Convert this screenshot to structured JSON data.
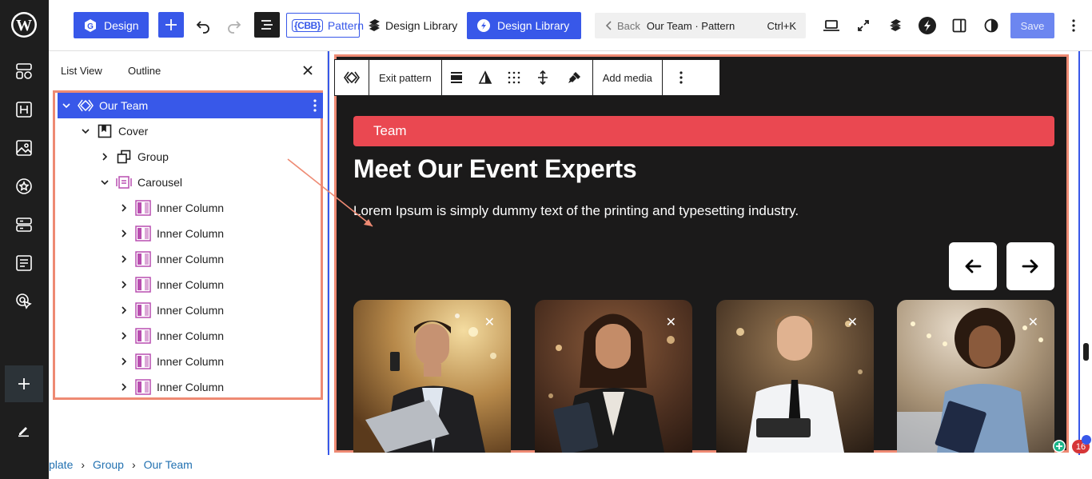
{
  "colors": {
    "accent": "#3858e9",
    "highlight": "#ee8a73",
    "team_pill": "#ea4851",
    "canvas_bg": "#1b1a1a"
  },
  "rail": {
    "icons": [
      "wordpress-logo-icon",
      "layout-icon",
      "heading-icon",
      "image-icon",
      "star-icon",
      "sections-icon",
      "form-icon",
      "cursor-click-icon",
      "plus-icon",
      "pencil-icon"
    ]
  },
  "toolbar": {
    "design_label": "Design",
    "pattern_label": "Pattern",
    "pattern_logo": "{CBB}",
    "design_library_label": "Design Library",
    "design_library_active_label": "Design Library",
    "command": {
      "back_label": "Back",
      "title": "Our Team · Pattern",
      "shortcut": "Ctrl+K"
    },
    "save_label": "Save"
  },
  "sidebar": {
    "tabs": [
      "List View",
      "Outline"
    ],
    "tree": [
      {
        "label": "Our Team",
        "level": 0,
        "expanded": true,
        "selected": true,
        "icon": "pattern-icon"
      },
      {
        "label": "Cover",
        "level": 1,
        "expanded": true,
        "icon": "cover-icon"
      },
      {
        "label": "Group",
        "level": 2,
        "expanded": false,
        "icon": "group-icon"
      },
      {
        "label": "Carousel",
        "level": 2,
        "expanded": true,
        "icon": "carousel-icon"
      },
      {
        "label": "Inner Column",
        "level": 3,
        "expanded": false,
        "icon": "column-icon"
      },
      {
        "label": "Inner Column",
        "level": 3,
        "expanded": false,
        "icon": "column-icon"
      },
      {
        "label": "Inner Column",
        "level": 3,
        "expanded": false,
        "icon": "column-icon"
      },
      {
        "label": "Inner Column",
        "level": 3,
        "expanded": false,
        "icon": "column-icon"
      },
      {
        "label": "Inner Column",
        "level": 3,
        "expanded": false,
        "icon": "column-icon"
      },
      {
        "label": "Inner Column",
        "level": 3,
        "expanded": false,
        "icon": "column-icon"
      },
      {
        "label": "Inner Column",
        "level": 3,
        "expanded": false,
        "icon": "column-icon"
      },
      {
        "label": "Inner Column",
        "level": 3,
        "expanded": false,
        "icon": "column-icon"
      }
    ]
  },
  "breadcrumb": [
    "plate",
    "Group",
    "Our Team"
  ],
  "block_toolbar": {
    "exit_label": "Exit pattern",
    "add_media_label": "Add media"
  },
  "canvas": {
    "pill_label": "Team",
    "heading": "Meet Our Event Experts",
    "subtext": "Lorem Ipsum is simply dummy text of the printing and typesetting industry.",
    "cards": [
      {
        "person": "man-with-phone-and-laptop"
      },
      {
        "person": "woman-with-tablet"
      },
      {
        "person": "man-with-tablet"
      },
      {
        "person": "woman-with-clipboard"
      }
    ],
    "close_glyph": "✕"
  },
  "notification_count": "16"
}
